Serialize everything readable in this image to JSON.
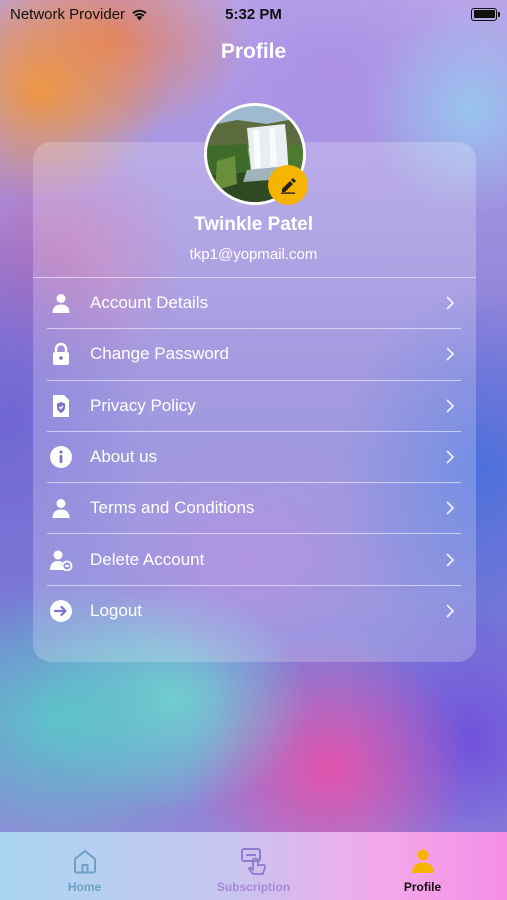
{
  "status_bar": {
    "carrier": "Network Provider",
    "time": "5:32 PM"
  },
  "header": {
    "title": "Profile"
  },
  "profile": {
    "name": "Twinkle Patel",
    "email": "tkp1@yopmail.com"
  },
  "menu": {
    "items": [
      {
        "label": "Account Details",
        "icon": "user-icon"
      },
      {
        "label": "Change Password",
        "icon": "lock-icon"
      },
      {
        "label": "Privacy Policy",
        "icon": "shield-document-icon"
      },
      {
        "label": "About us",
        "icon": "info-icon"
      },
      {
        "label": "Terms and Conditions",
        "icon": "user-icon"
      },
      {
        "label": "Delete Account",
        "icon": "user-remove-icon"
      },
      {
        "label": "Logout",
        "icon": "logout-icon"
      }
    ]
  },
  "tabbar": {
    "tabs": [
      {
        "label": "Home",
        "icon": "home-icon",
        "color": "#6f9fc4",
        "active": false
      },
      {
        "label": "Subscription",
        "icon": "subscription-icon",
        "color": "#a889d8",
        "active": false
      },
      {
        "label": "Profile",
        "icon": "person-icon",
        "color": "#111111",
        "active": true
      }
    ],
    "active_icon_color": "#f6b400"
  },
  "colors": {
    "edit_badge": "#f6b400"
  }
}
